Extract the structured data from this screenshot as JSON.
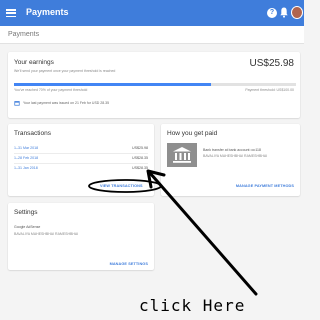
{
  "header": {
    "title": "Payments",
    "help_icon": "help-icon",
    "notifications_icon": "bell-icon",
    "avatar": "user-avatar"
  },
  "subheader": {
    "title": "Payments"
  },
  "earnings": {
    "title": "Your earnings",
    "subtitle": "We'll send your payment once your payment threshold is reached",
    "amount": "US$25.98",
    "progress": 0.7,
    "progress_left": "You've reached 70% of your payment threshold",
    "progress_right": "Payment threshold: US$100.00",
    "last_payment": "Your last payment was issued on 21 Feb for USD 28.35"
  },
  "transactions": {
    "title": "Transactions",
    "rows": [
      {
        "date": "1–31 Mar 2018",
        "amount": "US$25.98"
      },
      {
        "date": "1–28 Feb 2018",
        "amount": "US$28.35"
      },
      {
        "date": "1–31 Jan 2018",
        "amount": "US$28.35"
      }
    ],
    "action": "VIEW TRANSACTIONS"
  },
  "get_paid": {
    "title": "How you get paid",
    "method_line1": "Bank transfer at bank account ••••118",
    "method_line2": "BAVALIYA MAHESHBHAI RAMESHBHAI",
    "action": "MANAGE PAYMENT METHODS"
  },
  "settings": {
    "title": "Settings",
    "product": "Google AdSense",
    "owner": "BAVALIYA MAHESHBHAI RAMESHBHAI",
    "action": "MANAGE SETTINGS"
  },
  "annotation": {
    "text": "click Here"
  },
  "colors": {
    "appbar": "#3f7ddb",
    "accent": "#3f7ddb",
    "progress": "#4285f4"
  }
}
